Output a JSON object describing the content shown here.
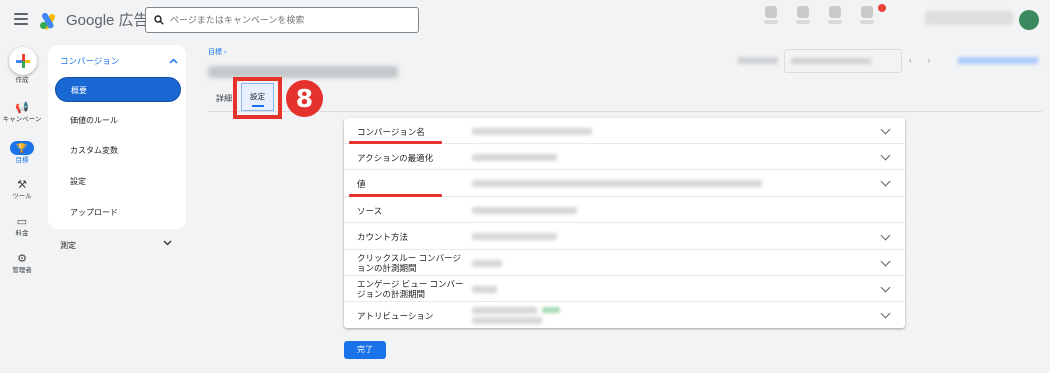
{
  "app": {
    "title": "Google 広告"
  },
  "search": {
    "placeholder": "ページまたはキャンペーンを検索"
  },
  "rail": {
    "create_label": "作成",
    "items": [
      {
        "label": "キャンペーン",
        "icon": "megaphone-icon"
      },
      {
        "label": "目標",
        "icon": "trophy-icon"
      },
      {
        "label": "ツール",
        "icon": "tools-icon"
      },
      {
        "label": "料金",
        "icon": "card-icon"
      },
      {
        "label": "管理者",
        "icon": "gear-icon"
      }
    ]
  },
  "subnav": {
    "section": "コンバージョン",
    "items": [
      "概要",
      "価値のルール",
      "カスタム変数",
      "設定",
      "アップロード"
    ],
    "active_index": 0,
    "measure": "測定"
  },
  "breadcrumb": "目標 ›",
  "tabs": {
    "detail": "詳細",
    "settings": "設定"
  },
  "annotation": {
    "step": "8",
    "color": "#e5322d"
  },
  "settings_rows": [
    {
      "label": "コンバージョン名",
      "expandable": true,
      "marked": true
    },
    {
      "label": "アクションの最適化",
      "expandable": true,
      "marked": false
    },
    {
      "label": "値",
      "expandable": true,
      "marked": true
    },
    {
      "label": "ソース",
      "expandable": false,
      "marked": false
    },
    {
      "label": "カウント方法",
      "expandable": true,
      "marked": false
    },
    {
      "label": "クリックスルー コンバージョンの計測期間",
      "expandable": true,
      "marked": false
    },
    {
      "label": "エンゲージ ビュー コンバージョンの計測期間",
      "expandable": true,
      "marked": false
    },
    {
      "label": "アトリビューション",
      "expandable": true,
      "marked": false
    }
  ],
  "done_button": "完了",
  "colors": {
    "accent": "#1a73e8",
    "highlight": "#e5322d"
  }
}
